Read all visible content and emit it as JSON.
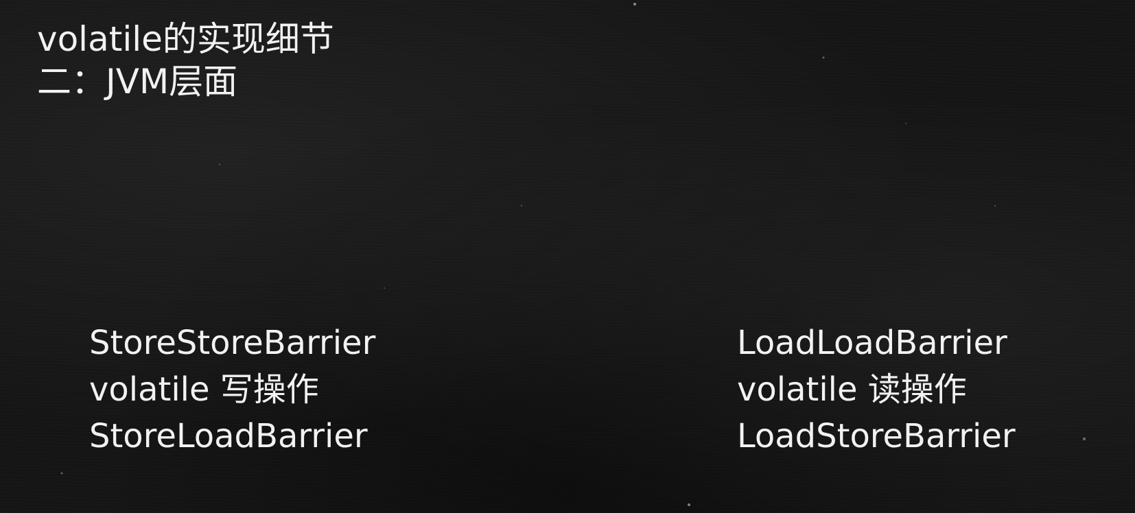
{
  "title": {
    "line1": "volatile的实现细节",
    "line2": "二：JVM层面"
  },
  "left_column": {
    "items": [
      "StoreStoreBarrier",
      "volatile 写操作",
      "StoreLoadBarrier"
    ]
  },
  "right_column": {
    "items": [
      "LoadLoadBarrier",
      "volatile 读操作",
      "LoadStoreBarrier"
    ]
  },
  "colors": {
    "background": "#141414",
    "text": "#f2f2f2"
  }
}
